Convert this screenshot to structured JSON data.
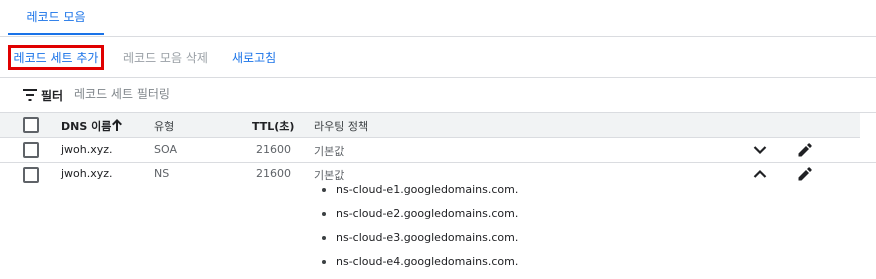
{
  "tabs": [
    {
      "label": "레코드 모음"
    }
  ],
  "actions": {
    "add_record_set": "레코드 세트 추가",
    "delete_record_sets": "레코드 모음 삭제",
    "refresh": "새로고침"
  },
  "filter": {
    "label": "필터",
    "placeholder": "레코드 세트 필터링"
  },
  "table": {
    "columns": {
      "dns_name": "DNS 이름",
      "type": "유형",
      "ttl": "TTL(초)",
      "routing_policy": "라우팅 정책"
    },
    "sort": {
      "column": "dns_name",
      "direction": "ascending",
      "icon": "arrow-upward-icon"
    },
    "rows": [
      {
        "dns_name": "jwoh.xyz.",
        "type": "SOA",
        "ttl": "21600",
        "routing_policy": "기본값",
        "expanded": false,
        "values": []
      },
      {
        "dns_name": "jwoh.xyz.",
        "type": "NS",
        "ttl": "21600",
        "routing_policy": "기본값",
        "expanded": true,
        "values": [
          "ns-cloud-e1.googledomains.com.",
          "ns-cloud-e2.googledomains.com.",
          "ns-cloud-e3.googledomains.com.",
          "ns-cloud-e4.googledomains.com."
        ]
      }
    ]
  },
  "colors": {
    "accent": "#1a73e8",
    "highlight_border": "#e00000",
    "divider": "#dadce0",
    "header_bg": "#f1f3f4",
    "disabled_text": "#9aa0a6"
  }
}
